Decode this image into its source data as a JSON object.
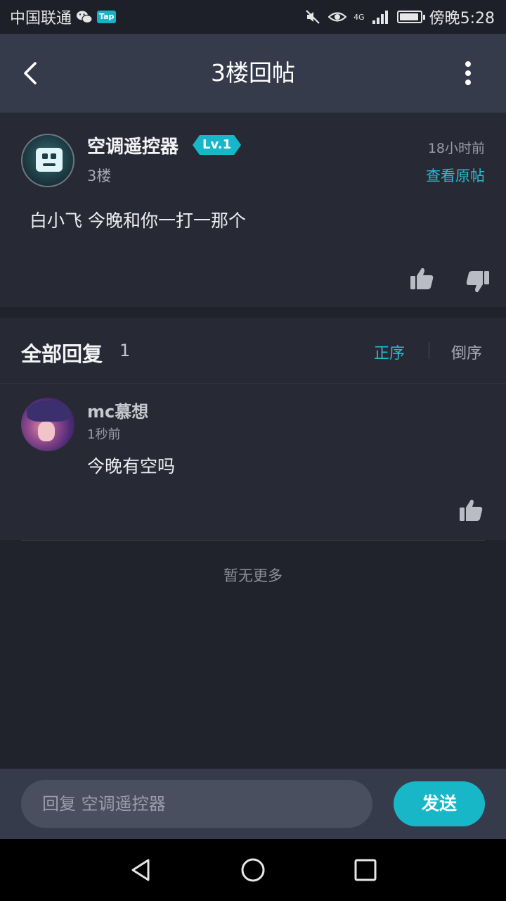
{
  "status_bar": {
    "carrier": "中国联通",
    "tap_badge": "Tap",
    "network": "4G",
    "time": "傍晚5:28",
    "battery_level": 0.95
  },
  "header": {
    "title": "3楼回帖",
    "back_icon": "chevron-left-icon",
    "more_icon": "more-vertical-icon"
  },
  "post": {
    "author": "空调遥控器",
    "level": "Lv.1",
    "floor": "3楼",
    "time": "18小时前",
    "view_original": "查看原帖",
    "content": "白小飞 今晚和你一打一那个"
  },
  "replies": {
    "title": "全部回复",
    "count": "1",
    "sort_asc": "正序",
    "sort_desc": "倒序",
    "items": [
      {
        "name": "mc慕想",
        "time": "1秒前",
        "content": "今晚有空吗"
      }
    ],
    "no_more": "暂无更多"
  },
  "input_bar": {
    "placeholder": "回复 空调遥控器",
    "send_label": "发送"
  },
  "colors": {
    "accent": "#17b7c8",
    "background": "#20222c",
    "card": "#272a35",
    "appbar": "#363b4b"
  }
}
